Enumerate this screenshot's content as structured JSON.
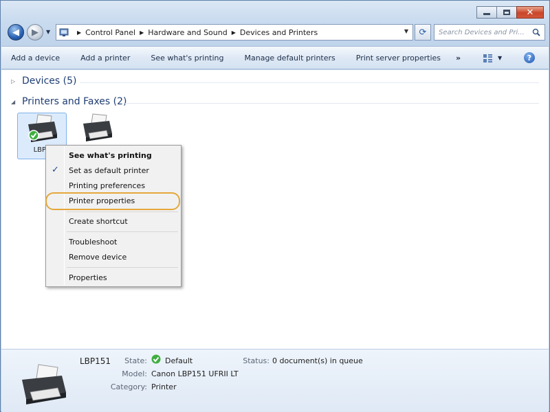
{
  "window": {
    "caption": {
      "minimize": "minimize",
      "maximize": "maximize",
      "close": "close"
    }
  },
  "address": {
    "crumbs": [
      "Control Panel",
      "Hardware and Sound",
      "Devices and Printers"
    ]
  },
  "search": {
    "placeholder": "Search Devices and Pri..."
  },
  "command_bar": {
    "items": [
      "Add a device",
      "Add a printer",
      "See what's printing",
      "Manage default printers",
      "Print server properties"
    ],
    "more": "»"
  },
  "groups": {
    "devices": {
      "label": "Devices (5)",
      "expanded": false
    },
    "printers": {
      "label": "Printers and Faxes (2)",
      "expanded": true
    }
  },
  "printers": [
    {
      "label": "LBP1",
      "selected": true,
      "default": true
    },
    {
      "label": "",
      "selected": false,
      "default": false
    }
  ],
  "context_menu": {
    "items": [
      {
        "label": "See what's printing",
        "bold": true,
        "checked": false
      },
      {
        "label": "Set as default printer",
        "bold": false,
        "checked": true
      },
      {
        "label": "Printing preferences",
        "bold": false,
        "checked": false
      },
      {
        "label": "Printer properties",
        "bold": false,
        "checked": false,
        "highlighted": true
      },
      {
        "label": "Create shortcut",
        "bold": false,
        "checked": false
      },
      {
        "label": "Troubleshoot",
        "bold": false,
        "checked": false
      },
      {
        "label": "Remove device",
        "bold": false,
        "checked": false
      },
      {
        "label": "Properties",
        "bold": false,
        "checked": false
      }
    ],
    "check_glyph": "✓"
  },
  "details": {
    "name": "LBP151",
    "state_label": "State:",
    "state_value": "Default",
    "model_label": "Model:",
    "model_value": "Canon LBP151 UFRII LT",
    "category_label": "Category:",
    "category_value": "Printer",
    "status_label": "Status:",
    "status_value": "0 document(s) in queue"
  },
  "colors": {
    "accent": "#e5a73b",
    "selection": "#dcebfc",
    "header_text": "#1e3d73",
    "default_check": "#3fae3f"
  },
  "icons": {
    "back": "back-arrow-icon",
    "forward": "forward-arrow-icon",
    "refresh": "refresh-icon",
    "search": "search-icon",
    "view": "view-options-icon",
    "help": "help-icon",
    "printer": "printer-icon",
    "default_badge": "default-check-icon"
  }
}
